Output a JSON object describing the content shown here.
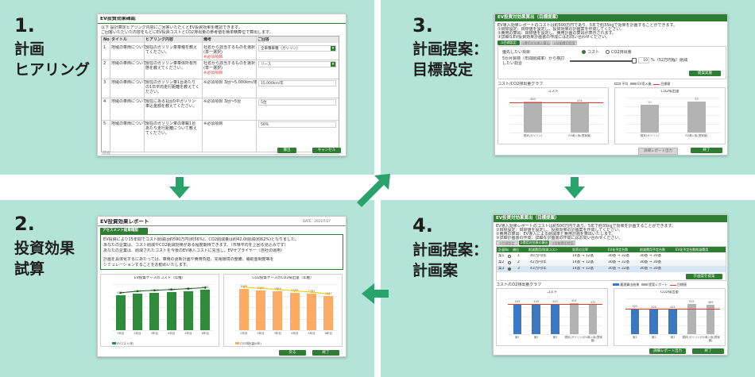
{
  "steps": [
    {
      "num": "1.",
      "title": "計画\nヒアリング"
    },
    {
      "num": "2.",
      "title": "投資効果\n試算"
    },
    {
      "num": "3.",
      "title": "計画提案：\n目標設定"
    },
    {
      "num": "4.",
      "title": "計画提案：\n計画案"
    }
  ],
  "s1": {
    "title": "EV投資効果確認",
    "intro1": "以下 設計算定ヒアリング内容にご回答いただくとEV投資効果を確認できます。",
    "intro2": "ご回答いただいた内容をもとにEV投資コストとCO2排出量の参考値を簡単精算位で算出します。",
    "headers": [
      "No",
      "タイトル",
      "ヒアリング内容",
      "備考",
      "ご回答"
    ],
    "rows": [
      {
        "no": "1",
        "title": "地域の車両について",
        "q": "現在のガソリン車車種を教えてください。",
        "note": "社名から該当するものを選択(単一選択)",
        "req": "※必須項目",
        "ans": "全車種車種（ガソリン）"
      },
      {
        "no": "2",
        "title": "地域の車両について",
        "q": "現在のガソリン車車体所有形態を教えてください。",
        "note": "社名から該当するものを選択(単一選択)",
        "req": "※必須項目",
        "ans": "リース"
      },
      {
        "no": "3",
        "title": "地域の車両について",
        "q": "現在のガソリン車1台あたりの1日平均走行距離を教えてください。",
        "note": "※必須項目 3回～5,000km/年",
        "req": "",
        "ans": "15,000km/年"
      },
      {
        "no": "4",
        "title": "地域の車両について",
        "q": "現在にある1回の中ガソリン車込金額を教えてください。",
        "note": "※必須項目 3回～5台",
        "req": "",
        "ans": "5台"
      },
      {
        "no": "5",
        "title": "地域の車両について",
        "q": "現在のガソリン車の車載1台あたり走行距離について教えてください。",
        "note": "※必須項目",
        "req": "",
        "ans": "50%"
      }
    ],
    "pager": "前頁",
    "btn_ok": "算出",
    "btn_cancel": "キャンセル"
  },
  "s2": {
    "title": "EV投資効果レポート",
    "date": "DATE：2021/7/27",
    "section": "アセスメント結果確認",
    "lines": [
      "EV投資により15年間でコスト削減は約590万円(約56%)、CO2削減量は約42.0t削減(約62%)となりました。",
      "あなたの企業は、コスト削減やCO2削減効果がある程度期待できます。（市場平均を上回る見込みです）",
      "あなたの企業は、削減されたコストを今後のEV導入コストに充当し、EVサプライヤー（自社の運用）",
      "計画を具体化するにあたっては、車両の更新計画や費用負担、充電環境の整備、補助金制度等を",
      "シミュレーションすることをお勧めいたします。"
    ],
    "chart_data": [
      {
        "type": "bar",
        "title": "EV投資ケースのコスト（年推）",
        "categories": [
          "1年目",
          "2年目",
          "3年目",
          "4年目",
          "5年目",
          "6年目"
        ],
        "values": [
          4211,
          4390,
          4490,
          4590,
          4690,
          4791
        ],
        "legend": "EVコスト(年)"
      },
      {
        "type": "bar",
        "title": "CO2投資ケースのCO2排出量（年推）",
        "categories": [
          "1年目",
          "2年目",
          "3年目",
          "4年目",
          "5年目",
          "6年目"
        ],
        "values": [
          1960,
          1900,
          1854,
          1790,
          1732,
          1647
        ],
        "legend": "CO2排出量(t/年)"
      }
    ],
    "btn_back": "戻る",
    "btn_end": "終了"
  },
  "s3": {
    "title": "EV投資対効果算出（目標提案）",
    "intro": [
      "EV導入効果レポートのコストは約500万円であり、5年で約35kgで効果を計画することができます。",
      "①目標設定：目標値を設定し、投資効果の計画案を作成してください。",
      "②費用の算出：目標値を設定し、費用計画の算出が表示されます。",
      "③詳細なEV投資効果計画書の作成にはお問い合わせください。"
    ],
    "tabs": [
      "①目標設定",
      "②費用対効果の算出",
      "③詳細費用提案"
    ],
    "goal_label": "優先したい項目",
    "radio1": "コスト",
    "radio2": "CO2排出量",
    "slider_label": "5か月目標（年間削減率）から検討したい割合",
    "slider_value": "10",
    "slider_suffix": "%（52万円程）削減",
    "btn_calc": "提案実施",
    "graph_title": "コスト/CO2排出量グラフ",
    "legend": [
      "平均",
      "EV導入後",
      "目標値"
    ],
    "chart_data": [
      {
        "type": "bar",
        "title": "コスト",
        "categories": [
          "現状(ガソリン)",
          "EV導入後(提案値)"
        ],
        "values": [
          464,
          432
        ]
      },
      {
        "type": "bar",
        "title": "CO2排出量",
        "categories": [
          "現状(ガソリン)",
          "EV導入後(提案値)"
        ],
        "values": [
          22,
          25
        ]
      }
    ],
    "btn_report": "詳細レポート出力",
    "btn_end": "終了"
  },
  "s4": {
    "title": "EV投資対効果算出（目標提案）",
    "intro": [
      "EV導入効果レポートのコストは約500万円であり、5年で約35kgで効果を計画することができます。",
      "①目標設定：目標値を設定し、投資効果の計画案を作成してください。",
      "②費用の算出：EV導入による削減率と費用計画を算出いたします。",
      "③詳細計画書の作成：詳細な計画書の作成にはお問い合わせください。"
    ],
    "tabs": [
      "①目標設定",
      "②費用対効果の算出",
      "③詳細費用提案"
    ],
    "headers": [
      "計画No",
      "順位",
      "削減費用/削減コスト",
      "効率の比率",
      "EV化予定台数",
      "削減費用予定台数",
      "EV化予定台数削減費用"
    ],
    "rows": [
      [
        "案1",
        "1",
        "40万円/年",
        "14基 → 12基",
        "30基 → 32基",
        "30基 → 30基"
      ],
      [
        "案2",
        "2",
        "42万円/年",
        "14基 → 12基",
        "30基 → 32基",
        "30基 → 30基"
      ],
      [
        "案3",
        "3",
        "43万円/年",
        "14基 → 12基",
        "30基 → 32基",
        "30基 → 30基"
      ]
    ],
    "btn_show": "計画案を提案",
    "graph_title": "コスト/CO2排出量グラフ",
    "legend": [
      "最適算出結果",
      "提案レポート",
      "目標値"
    ],
    "chart_data": [
      {
        "type": "bar",
        "title": "コスト",
        "categories": [
          "案1",
          "案2",
          "案3",
          "現状(ガソリン)",
          "EV導入後(提案値)"
        ],
        "values": [
          443,
          443,
          443,
          454,
          432
        ]
      },
      {
        "type": "bar",
        "title": "CO2排出量",
        "categories": [
          "案1",
          "案2",
          "案3",
          "現状(ガソリン)",
          "EV導入後(提案値)"
        ],
        "values": [
          422,
          420,
          411,
          512,
          489
        ]
      }
    ],
    "btn_report": "詳細レポート出力",
    "btn_end": "終了"
  },
  "colors": {
    "bg": "#b4e3d8",
    "green": "#2e7d32",
    "arrow": "#27a36b",
    "orange": "#ffab66",
    "blue": "#3a78c2"
  }
}
